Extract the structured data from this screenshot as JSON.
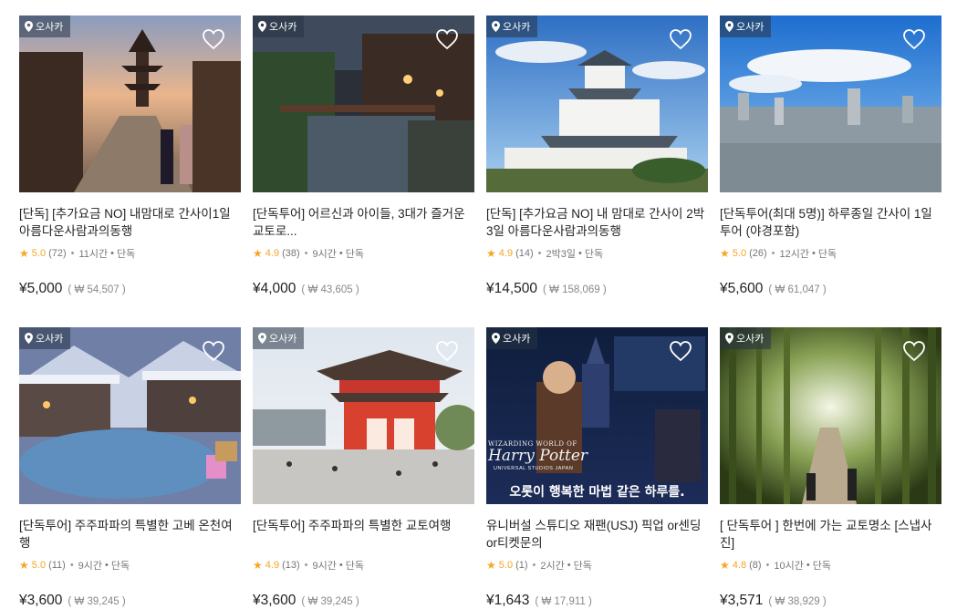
{
  "products": [
    {
      "location": "오사카",
      "title": "[단독] [추가요금 NO] 내맘대로 간사이1일 아름다운사람과의동행",
      "rating": "5.0",
      "reviews": "(72)",
      "duration": "11시간",
      "type": "단독",
      "price": "¥5,000",
      "krw": "( ₩ 54,507 )"
    },
    {
      "location": "오사카",
      "title": "[단독투어] 어르신과 아이들, 3대가 즐거운 교토로...",
      "rating": "4.9",
      "reviews": "(38)",
      "duration": "9시간",
      "type": "단독",
      "price": "¥4,000",
      "krw": "( ₩ 43,605 )"
    },
    {
      "location": "오사카",
      "title": "[단독] [추가요금 NO] 내 맘대로 간사이 2박3일 아름다운사람과의동행",
      "rating": "4.9",
      "reviews": "(14)",
      "duration": "2박3일",
      "type": "단독",
      "price": "¥14,500",
      "krw": "( ₩ 158,069 )"
    },
    {
      "location": "오사카",
      "title": "[단독투어(최대 5명)] 하루종일 간사이 1일투어 (야경포함)",
      "rating": "5.0",
      "reviews": "(26)",
      "duration": "12시간",
      "type": "단독",
      "price": "¥5,600",
      "krw": "( ₩ 61,047 )"
    },
    {
      "location": "오사카",
      "title": "[단독투어] 주주파파의 특별한 고베 온천여행",
      "rating": "5.0",
      "reviews": "(11)",
      "duration": "9시간",
      "type": "단독",
      "price": "¥3,600",
      "krw": "( ₩ 39,245 )"
    },
    {
      "location": "오사카",
      "title": "[단독투어] 주주파파의 특별한 교토여행",
      "rating": "4.9",
      "reviews": "(13)",
      "duration": "9시간",
      "type": "단독",
      "price": "¥3,600",
      "krw": "( ₩ 39,245 )"
    },
    {
      "location": "오사카",
      "title": "유니버설 스튜디오 재팬(USJ) 픽업 or센딩 or티켓문의",
      "rating": "5.0",
      "reviews": "(1)",
      "duration": "2시간",
      "type": "단독",
      "price": "¥1,643",
      "krw": "( ₩ 17,911 )",
      "banner_text": "오롯이 행복한 마법 같은 하루를.",
      "logo_text": "Harry Potter",
      "logo_sub": "WIZARDING WORLD OF",
      "logo_sub2": "UNIVERSAL STUDIOS JAPAN"
    },
    {
      "location": "오사카",
      "title": "[ 단독투어 ] 한번에 가는 교토명소 [스냅사진]",
      "rating": "4.8",
      "reviews": "(8)",
      "duration": "10시간",
      "type": "단독",
      "price": "¥3,571",
      "krw": "( ₩ 38,929 )"
    }
  ],
  "colors": {
    "star": "#f5a623",
    "badge": "rgba(40,52,70,0.55)"
  },
  "icons": {
    "location": "location-pin-icon",
    "wish": "heart-outline-icon",
    "rating": "star-icon"
  }
}
